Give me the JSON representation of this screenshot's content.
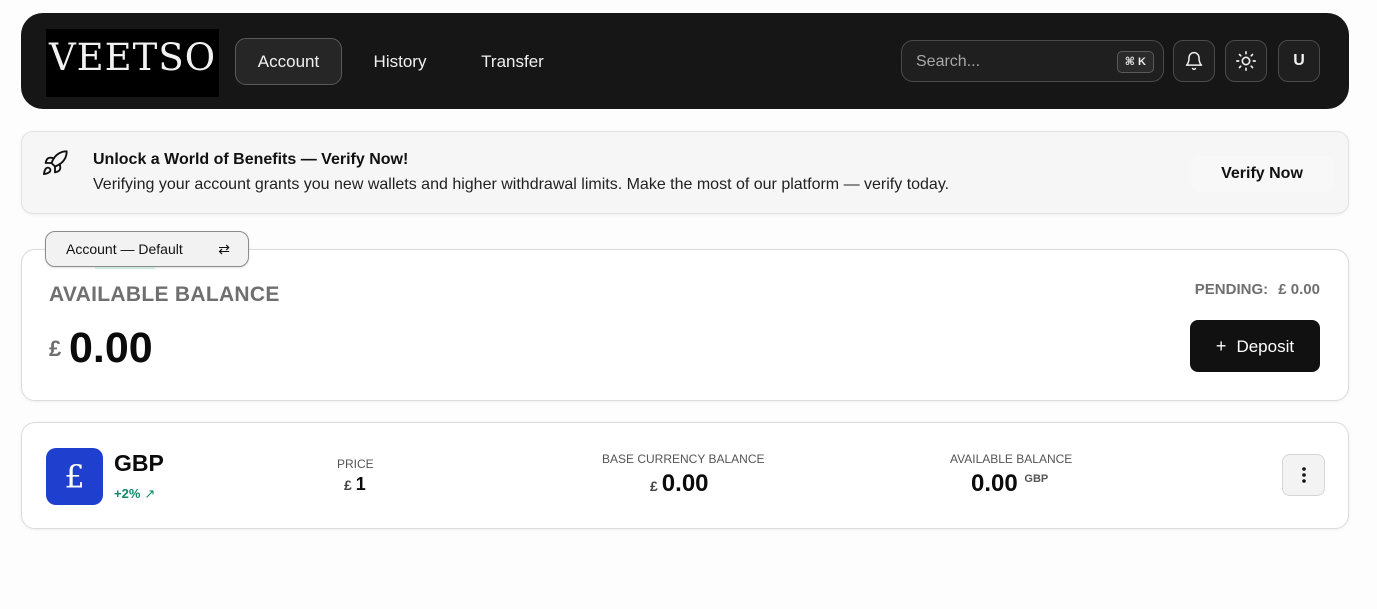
{
  "header": {
    "logo_text": "VEETSO",
    "tabs": [
      {
        "label": "Account",
        "active": true
      },
      {
        "label": "History",
        "active": false
      },
      {
        "label": "Transfer",
        "active": false
      }
    ],
    "search": {
      "placeholder": "Search...",
      "shortcut": "⌘ K"
    },
    "icons": [
      "bell-icon",
      "sun-icon"
    ],
    "avatar_initial": "U"
  },
  "banner": {
    "icon": "rocket-icon",
    "title": "Unlock a World of Benefits — Verify Now!",
    "text": "Verifying your account grants you new wallets and higher withdrawal limits. Make the most of our platform — verify today.",
    "button_label": "Verify Now"
  },
  "balance": {
    "account_selector": "Account — Default",
    "label": "AVAILABLE BALANCE",
    "pending_label": "PENDING:",
    "pending_currency": "£",
    "pending_amount": "0.00",
    "currency_symbol": "£",
    "amount": "0.00",
    "deposit_label": "Deposit"
  },
  "currency_row": {
    "symbol": "£",
    "code": "GBP",
    "change": "+2%",
    "change_arrow": "↗",
    "price_label": "PRICE",
    "price_symbol": "£",
    "price_value": "1",
    "base_label": "BASE CURRENCY BALANCE",
    "base_symbol": "£",
    "base_value": "0.00",
    "available_label": "AVAILABLE BALANCE",
    "available_value": "0.00",
    "available_unit": "GBP"
  },
  "colors": {
    "nav_bg": "#161616",
    "accent_blue": "#1f3fcf",
    "positive_green": "#0f8a6a",
    "button_dark": "#111111"
  }
}
